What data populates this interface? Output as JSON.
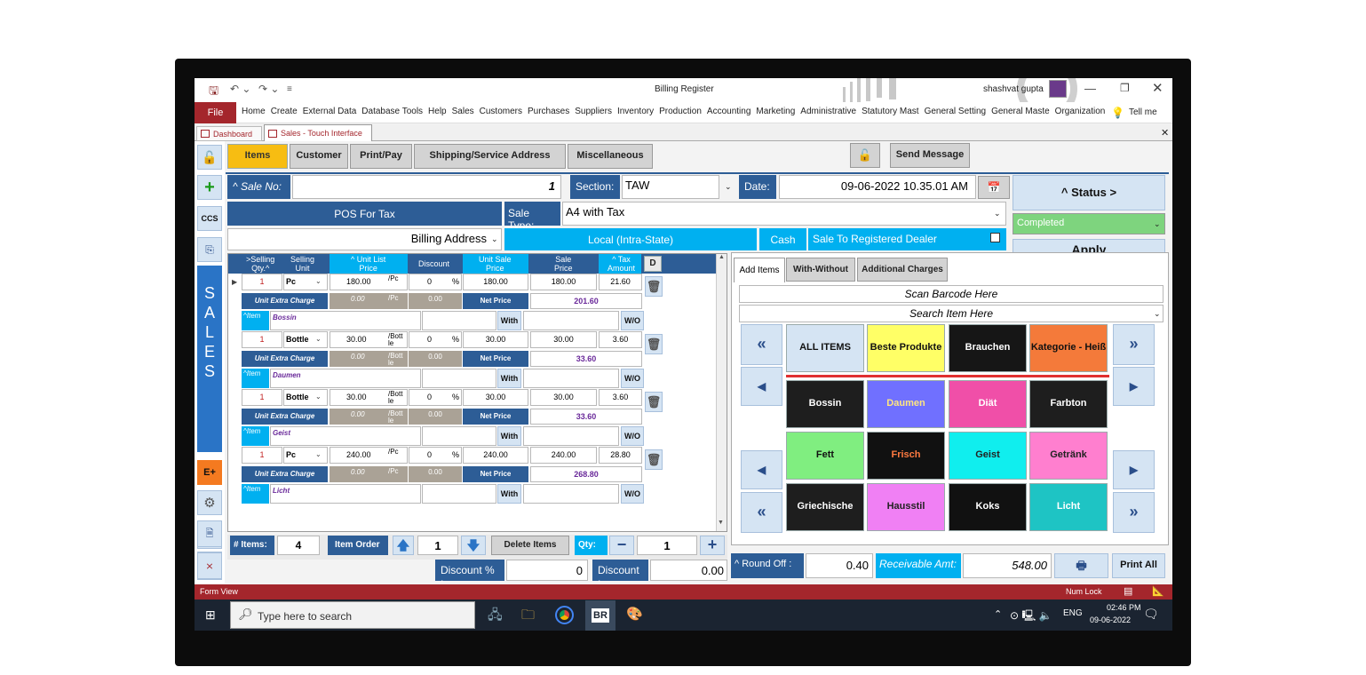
{
  "title_bar": {
    "title": "Billing Register",
    "user": "shashvat gupta"
  },
  "ribbon": {
    "file": "File",
    "items": [
      "Home",
      "Create",
      "External Data",
      "Database Tools",
      "Help",
      "Sales",
      "Customers",
      "Purchases",
      "Suppliers",
      "Inventory",
      "Production",
      "Accounting",
      "Marketing",
      "Administrative",
      "Statutory Mast",
      "General Setting",
      "General Maste",
      "Organization"
    ],
    "tell_me": "Tell me"
  },
  "doc_tabs": [
    "Dashboard",
    "Sales - Touch Interface"
  ],
  "sidebar": {
    "ccs": "CCS",
    "sales_letters": [
      "S",
      "A",
      "L",
      "E",
      "S"
    ],
    "eplus": "E+"
  },
  "top_tabs": [
    "Items",
    "Customer",
    "Print/Pay",
    "Shipping/Service Address",
    "Miscellaneous"
  ],
  "send_message": "Send Message",
  "header": {
    "sale_no_label": "^ Sale No:",
    "sale_no": "1",
    "section_label": "Section:",
    "section": "TAW",
    "date_label": "Date:",
    "date": "09-06-2022 10.35.01 AM",
    "pos": "POS For Tax",
    "sale_type_label": "Sale Type:",
    "sale_type": "A4 with Tax",
    "billing_address": "Billing Address",
    "local": "Local (Intra-State)",
    "cash": "Cash",
    "registered": "Sale To Registered Dealer"
  },
  "status": {
    "label": "^ Status >",
    "value": "Completed",
    "apply": "Apply\nDiscount"
  },
  "grid": {
    "headers": [
      ">Selling\nQty.^",
      "Selling\nUnit",
      "^ Unit List\nPrice",
      "Discount",
      "Unit Sale\nPrice",
      "Sale\nPrice",
      "^ Tax\nAmount"
    ],
    "d": "D",
    "extra_label": "Unit Extra Charge",
    "net_label": "Net Price",
    "item_label": "^Item",
    "with": "With",
    "wo": "W/O",
    "rows": [
      {
        "qty": "1",
        "unit": "Pc",
        "list": "180.00",
        "per": "/Pc",
        "disc": "0",
        "pct": "%",
        "usale": "180.00",
        "sale": "180.00",
        "tax": "21.60",
        "extra": "0.00",
        "extra_per": "/Pc",
        "extra2": "0.00",
        "net": "201.60",
        "item": "Bossin"
      },
      {
        "qty": "1",
        "unit": "Bottle",
        "list": "30.00",
        "per": "/Bott le",
        "disc": "0",
        "pct": "%",
        "usale": "30.00",
        "sale": "30.00",
        "tax": "3.60",
        "extra": "0.00",
        "extra_per": "/Bott le",
        "extra2": "0.00",
        "net": "33.60",
        "item": "Daumen"
      },
      {
        "qty": "1",
        "unit": "Bottle",
        "list": "30.00",
        "per": "/Bott le",
        "disc": "0",
        "pct": "%",
        "usale": "30.00",
        "sale": "30.00",
        "tax": "3.60",
        "extra": "0.00",
        "extra_per": "/Bott le",
        "extra2": "0.00",
        "net": "33.60",
        "item": "Geist"
      },
      {
        "qty": "1",
        "unit": "Pc",
        "list": "240.00",
        "per": "/Pc",
        "disc": "0",
        "pct": "%",
        "usale": "240.00",
        "sale": "240.00",
        "tax": "28.80",
        "extra": "0.00",
        "extra_per": "/Pc",
        "extra2": "0.00",
        "net": "268.80",
        "item": "Licht"
      }
    ]
  },
  "bottom": {
    "items_label": "# Items:",
    "items": "4",
    "order_label": "Item Order",
    "order": "1",
    "delete": "Delete Items",
    "qty_label": "Qty:",
    "qty": "1",
    "disc_pct_label": "Discount % :",
    "disc_pct": "0",
    "disc_label": "Discount :",
    "disc": "0.00",
    "round_label": "^ Round Off :",
    "round": "0.40",
    "recv_label": "Receivable Amt:",
    "recv": "548.00",
    "print_all": "Print All"
  },
  "right_tabs": [
    "Add Items",
    "With-Without",
    "Additional Charges"
  ],
  "scan": "Scan Barcode Here",
  "search_item": "Search Item Here",
  "categories": [
    {
      "label": "ALL ITEMS",
      "color": "#d5e4f3",
      "fg": "#111"
    },
    {
      "label": "Beste Produkte",
      "color": "#ffff66",
      "fg": "#111"
    },
    {
      "label": "Brauchen",
      "color": "#161616",
      "fg": "#fff"
    },
    {
      "label": "Kategorie - Heiß",
      "color": "#f47a3a",
      "fg": "#111"
    }
  ],
  "products": [
    {
      "label": "Bossin",
      "color": "#1e1e1e",
      "fg": "#fff"
    },
    {
      "label": "Daumen",
      "color": "#7070ff",
      "fg": "#ffe680"
    },
    {
      "label": "Diät",
      "color": "#f04fa8",
      "fg": "#fff"
    },
    {
      "label": "Farbton",
      "color": "#1e1e1e",
      "fg": "#fff"
    },
    {
      "label": "Fett",
      "color": "#80ee80",
      "fg": "#111"
    },
    {
      "label": "Frisch",
      "color": "#111111",
      "fg": "#ff7a40"
    },
    {
      "label": "Geist",
      "color": "#10eeee",
      "fg": "#222"
    },
    {
      "label": "Getränk",
      "color": "#ff7fcf",
      "fg": "#222"
    },
    {
      "label": "Griechische",
      "color": "#1e1e1e",
      "fg": "#fff"
    },
    {
      "label": "Hausstil",
      "color": "#f080f4",
      "fg": "#222"
    },
    {
      "label": "Koks",
      "color": "#111111",
      "fg": "#fff"
    },
    {
      "label": "Licht",
      "color": "#1ec4c4",
      "fg": "#fff"
    }
  ],
  "statusbar": {
    "left": "Form View",
    "right": "Num Lock"
  },
  "taskbar": {
    "search": "Type here to search",
    "lang": "ENG",
    "time": "02:46 PM",
    "date": "09-06-2022",
    "br": "BR"
  }
}
